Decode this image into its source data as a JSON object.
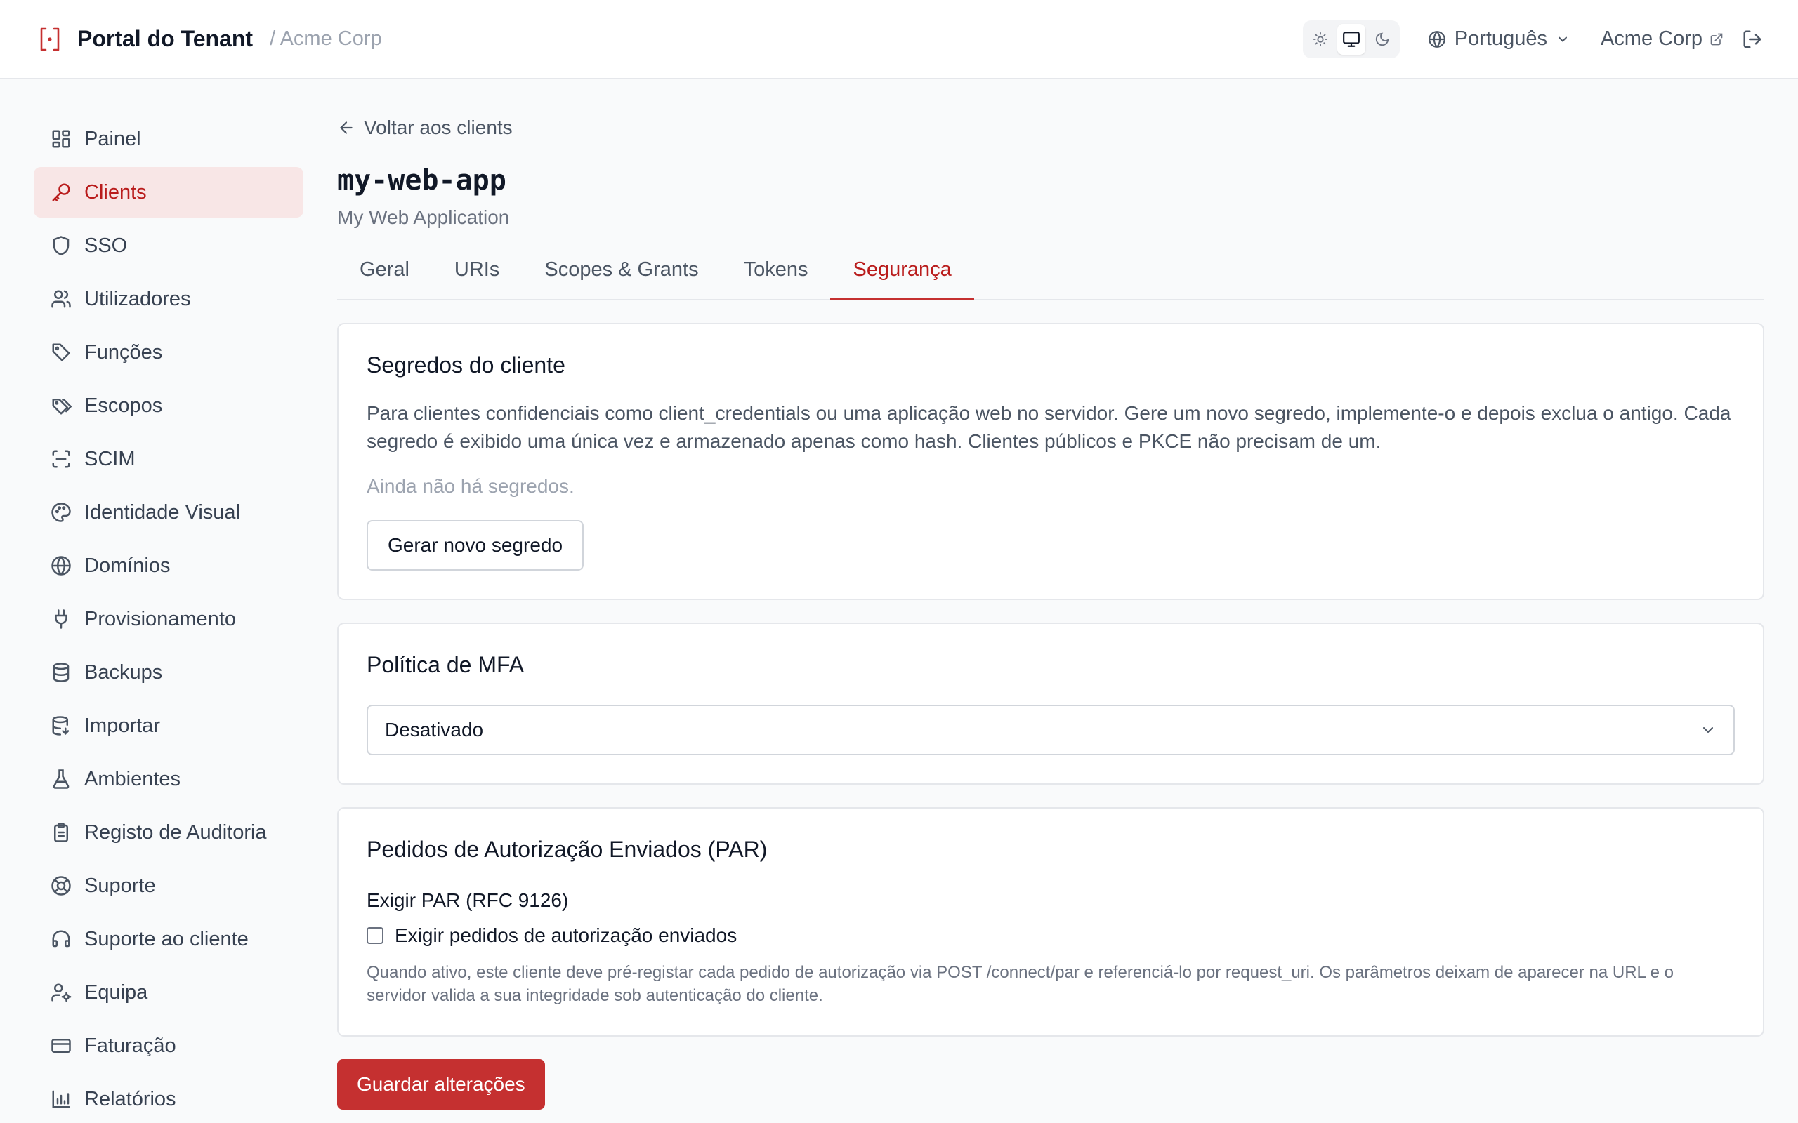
{
  "header": {
    "brand": "Portal do Tenant",
    "tenant_crumb": "/ Acme Corp",
    "theme_options": [
      "light",
      "system",
      "dark"
    ],
    "theme_active": "system",
    "language": "Português",
    "account": "Acme Corp"
  },
  "sidebar": {
    "items": [
      {
        "label": "Painel",
        "icon": "dashboard-icon"
      },
      {
        "label": "Clients",
        "icon": "key-icon",
        "active": true
      },
      {
        "label": "SSO",
        "icon": "shield-icon"
      },
      {
        "label": "Utilizadores",
        "icon": "users-icon"
      },
      {
        "label": "Funções",
        "icon": "tag-icon"
      },
      {
        "label": "Escopos",
        "icon": "tags-icon"
      },
      {
        "label": "SCIM",
        "icon": "scan-icon"
      },
      {
        "label": "Identidade Visual",
        "icon": "palette-icon"
      },
      {
        "label": "Domínios",
        "icon": "globe-icon"
      },
      {
        "label": "Provisionamento",
        "icon": "plug-icon"
      },
      {
        "label": "Backups",
        "icon": "database-icon"
      },
      {
        "label": "Importar",
        "icon": "database-import-icon"
      },
      {
        "label": "Ambientes",
        "icon": "flask-icon"
      },
      {
        "label": "Registo de Auditoria",
        "icon": "clipboard-icon"
      },
      {
        "label": "Suporte",
        "icon": "lifebuoy-icon"
      },
      {
        "label": "Suporte ao cliente",
        "icon": "headset-icon"
      },
      {
        "label": "Equipa",
        "icon": "user-cog-icon"
      },
      {
        "label": "Faturação",
        "icon": "credit-card-icon"
      },
      {
        "label": "Relatórios",
        "icon": "bar-chart-icon"
      }
    ]
  },
  "main": {
    "back_link": "Voltar aos clients",
    "client_id": "my-web-app",
    "client_name": "My Web Application",
    "tabs": [
      {
        "label": "Geral"
      },
      {
        "label": "URIs"
      },
      {
        "label": "Scopes & Grants"
      },
      {
        "label": "Tokens"
      },
      {
        "label": "Segurança",
        "active": true
      }
    ],
    "secrets": {
      "title": "Segredos do cliente",
      "description": "Para clientes confidenciais como client_credentials ou uma aplicação web no servidor. Gere um novo segredo, implemente-o e depois exclua o antigo. Cada segredo é exibido uma única vez e armazenado apenas como hash. Clientes públicos e PKCE não precisam de um.",
      "empty": "Ainda não há segredos.",
      "button": "Gerar novo segredo"
    },
    "mfa": {
      "title": "Política de MFA",
      "selected": "Desativado"
    },
    "par": {
      "title": "Pedidos de Autorização Enviados (PAR)",
      "field_label": "Exigir PAR (RFC 9126)",
      "checkbox_label": "Exigir pedidos de autorização enviados",
      "checked": false,
      "hint": "Quando ativo, este cliente deve pré-registar cada pedido de autorização via POST /connect/par e referenciá-lo por request_uri. Os parâmetros deixam de aparecer na URL e o servidor valida a sua integridade sob autenticação do cliente."
    },
    "save_button": "Guardar alterações"
  },
  "colors": {
    "accent": "#c53030",
    "active_nav_bg": "#f8e6e6",
    "border": "#e5e7eb"
  }
}
